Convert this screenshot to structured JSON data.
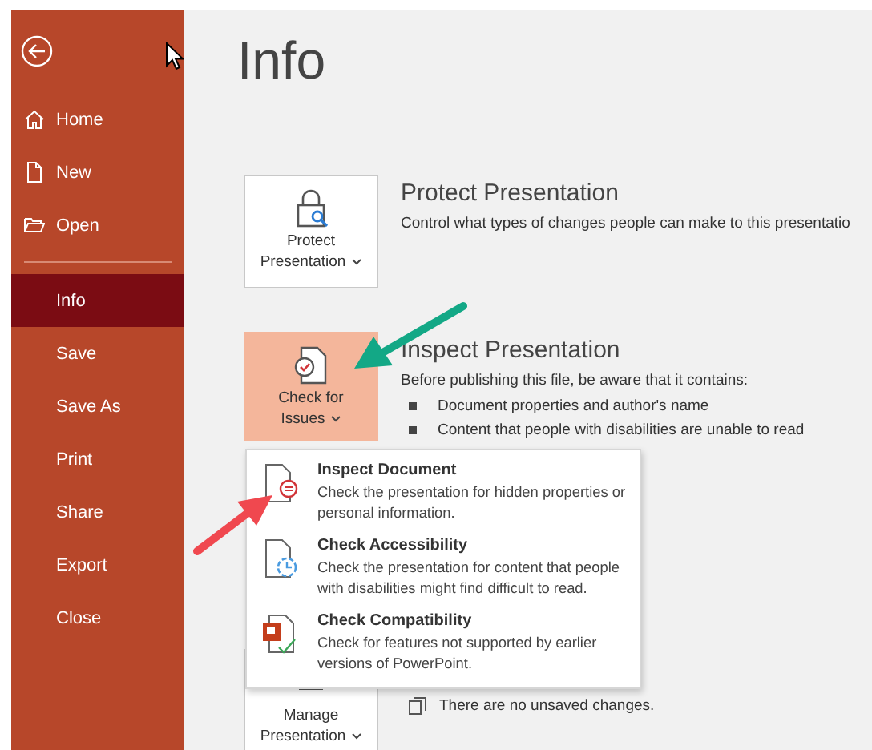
{
  "sidebar": {
    "items": [
      {
        "label": "Home",
        "selected": false
      },
      {
        "label": "New",
        "selected": false
      },
      {
        "label": "Open",
        "selected": false
      },
      {
        "label": "Info",
        "selected": true
      },
      {
        "label": "Save",
        "selected": false
      },
      {
        "label": "Save As",
        "selected": false
      },
      {
        "label": "Print",
        "selected": false
      },
      {
        "label": "Share",
        "selected": false
      },
      {
        "label": "Export",
        "selected": false
      },
      {
        "label": "Close",
        "selected": false
      }
    ]
  },
  "page_title": "Info",
  "sections": [
    {
      "kind": "protect",
      "button": {
        "label_lines": [
          "Protect",
          "Presentation"
        ],
        "highlighted": false
      },
      "title": "Protect Presentation",
      "description": "Control what types of changes people can make to this presentatio"
    },
    {
      "kind": "inspect",
      "button": {
        "label_lines": [
          "Check for",
          "Issues"
        ],
        "highlighted": true
      },
      "title": "Inspect Presentation",
      "description": "Before publishing this file, be aware that it contains:",
      "bullets": [
        "Document properties and author's name",
        "Content that people with disabilities are unable to read"
      ]
    },
    {
      "kind": "manage",
      "button": {
        "label_lines": [
          "Manage",
          "Presentation"
        ],
        "highlighted": false
      },
      "status": "There are no unsaved changes."
    }
  ],
  "menu": {
    "items": [
      {
        "kind": "inspect",
        "title": "Inspect Document",
        "description": "Check the presentation for hidden properties or personal information."
      },
      {
        "kind": "accessibility",
        "title": "Check Accessibility",
        "description": "Check the presentation for content that people with disabilities might find difficult to read."
      },
      {
        "kind": "compatibility",
        "title": "Check Compatibility",
        "description": "Check for features not supported by earlier versions of PowerPoint."
      }
    ]
  }
}
